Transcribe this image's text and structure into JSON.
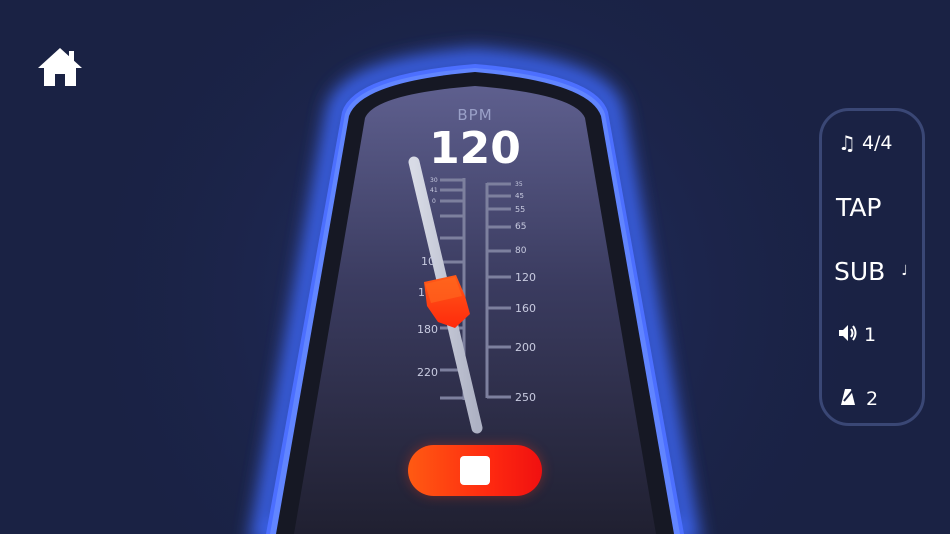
{
  "bpm": {
    "label": "BPM",
    "value": "120"
  },
  "scale_left": {
    "small_labels": [
      "30",
      "41",
      "0"
    ],
    "labels": [
      "10",
      "1",
      "180",
      "220"
    ]
  },
  "scale_right": {
    "small_labels": [
      "35",
      "45",
      "55",
      "65",
      "80"
    ],
    "labels": [
      "120",
      "160",
      "200",
      "250"
    ]
  },
  "stop_button": {
    "state": "playing",
    "icon": "stop-icon"
  },
  "side_panel": {
    "time_signature": {
      "icon": "music-note-icon",
      "value": "4/4"
    },
    "tap": {
      "label": "TAP"
    },
    "subdivision": {
      "label": "SUB",
      "icon": "quarter-note-icon"
    },
    "volume": {
      "icon": "speaker-icon",
      "value": "1"
    },
    "sound": {
      "icon": "metronome-icon",
      "value": "2"
    }
  },
  "colors": {
    "background": "#1a2244",
    "accent_glow": "#4a6cff",
    "button_orange": "#ff5a12",
    "button_red": "#f01010",
    "weight": "#ff3a10"
  },
  "icons": [
    "home-icon",
    "music-note-icon",
    "quarter-note-icon",
    "speaker-icon",
    "metronome-icon",
    "stop-icon"
  ]
}
